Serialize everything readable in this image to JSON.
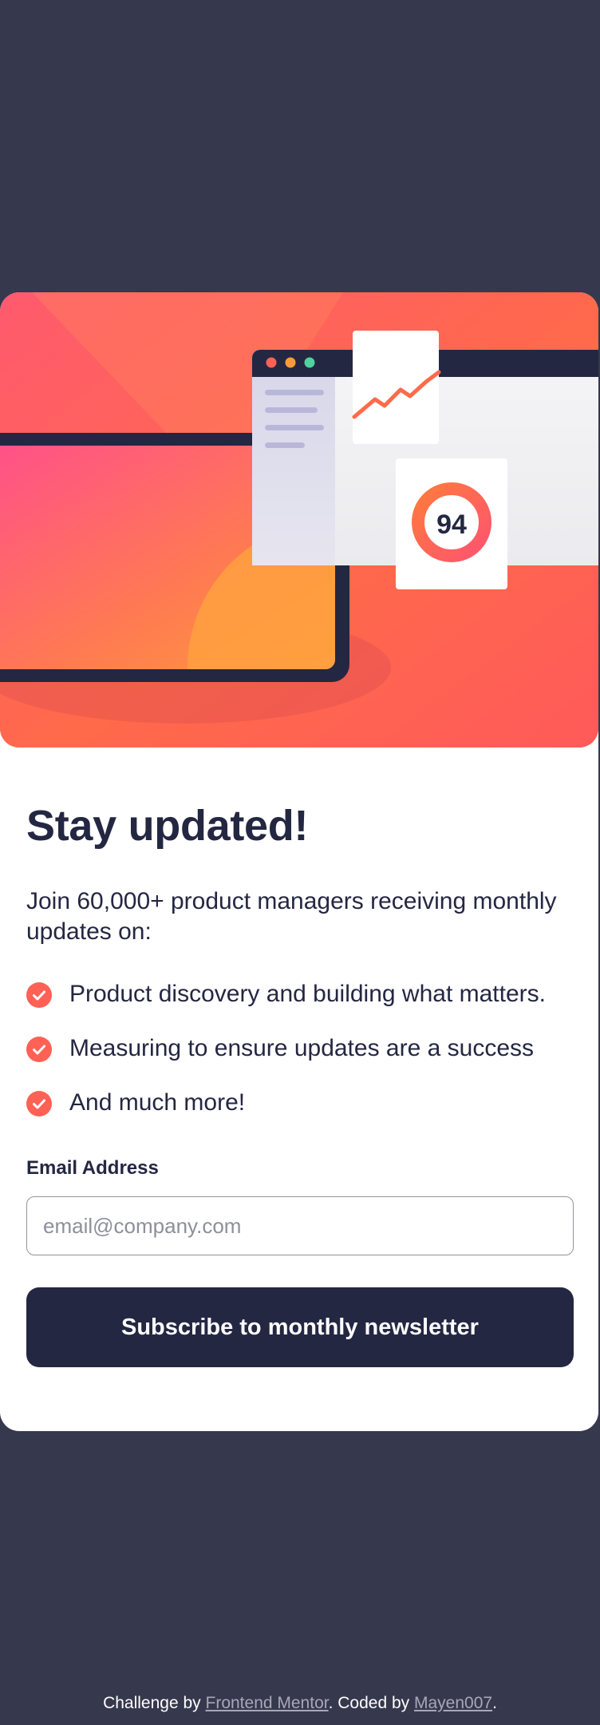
{
  "card": {
    "title": "Stay updated!",
    "intro": "Join 60,000+ product managers receiving monthly updates on:",
    "features": [
      "Product discovery and building what matters.",
      "Measuring to ensure updates are a success",
      "And much more!"
    ],
    "score": "94",
    "form": {
      "email_label": "Email Address",
      "email_placeholder": "email@company.com",
      "email_value": "",
      "submit_label": "Subscribe to monthly newsletter"
    }
  },
  "footer": {
    "prefix": "Challenge by ",
    "mentor_link": "Frontend Mentor",
    "middle": ". Coded by ",
    "author_link": "Mayen007",
    "suffix": "."
  },
  "colors": {
    "page_background": "#36384d",
    "dark_navy": "#242742",
    "tomato": "#ff6155",
    "white": "#ffffff"
  },
  "icons": [
    "check-icon"
  ]
}
